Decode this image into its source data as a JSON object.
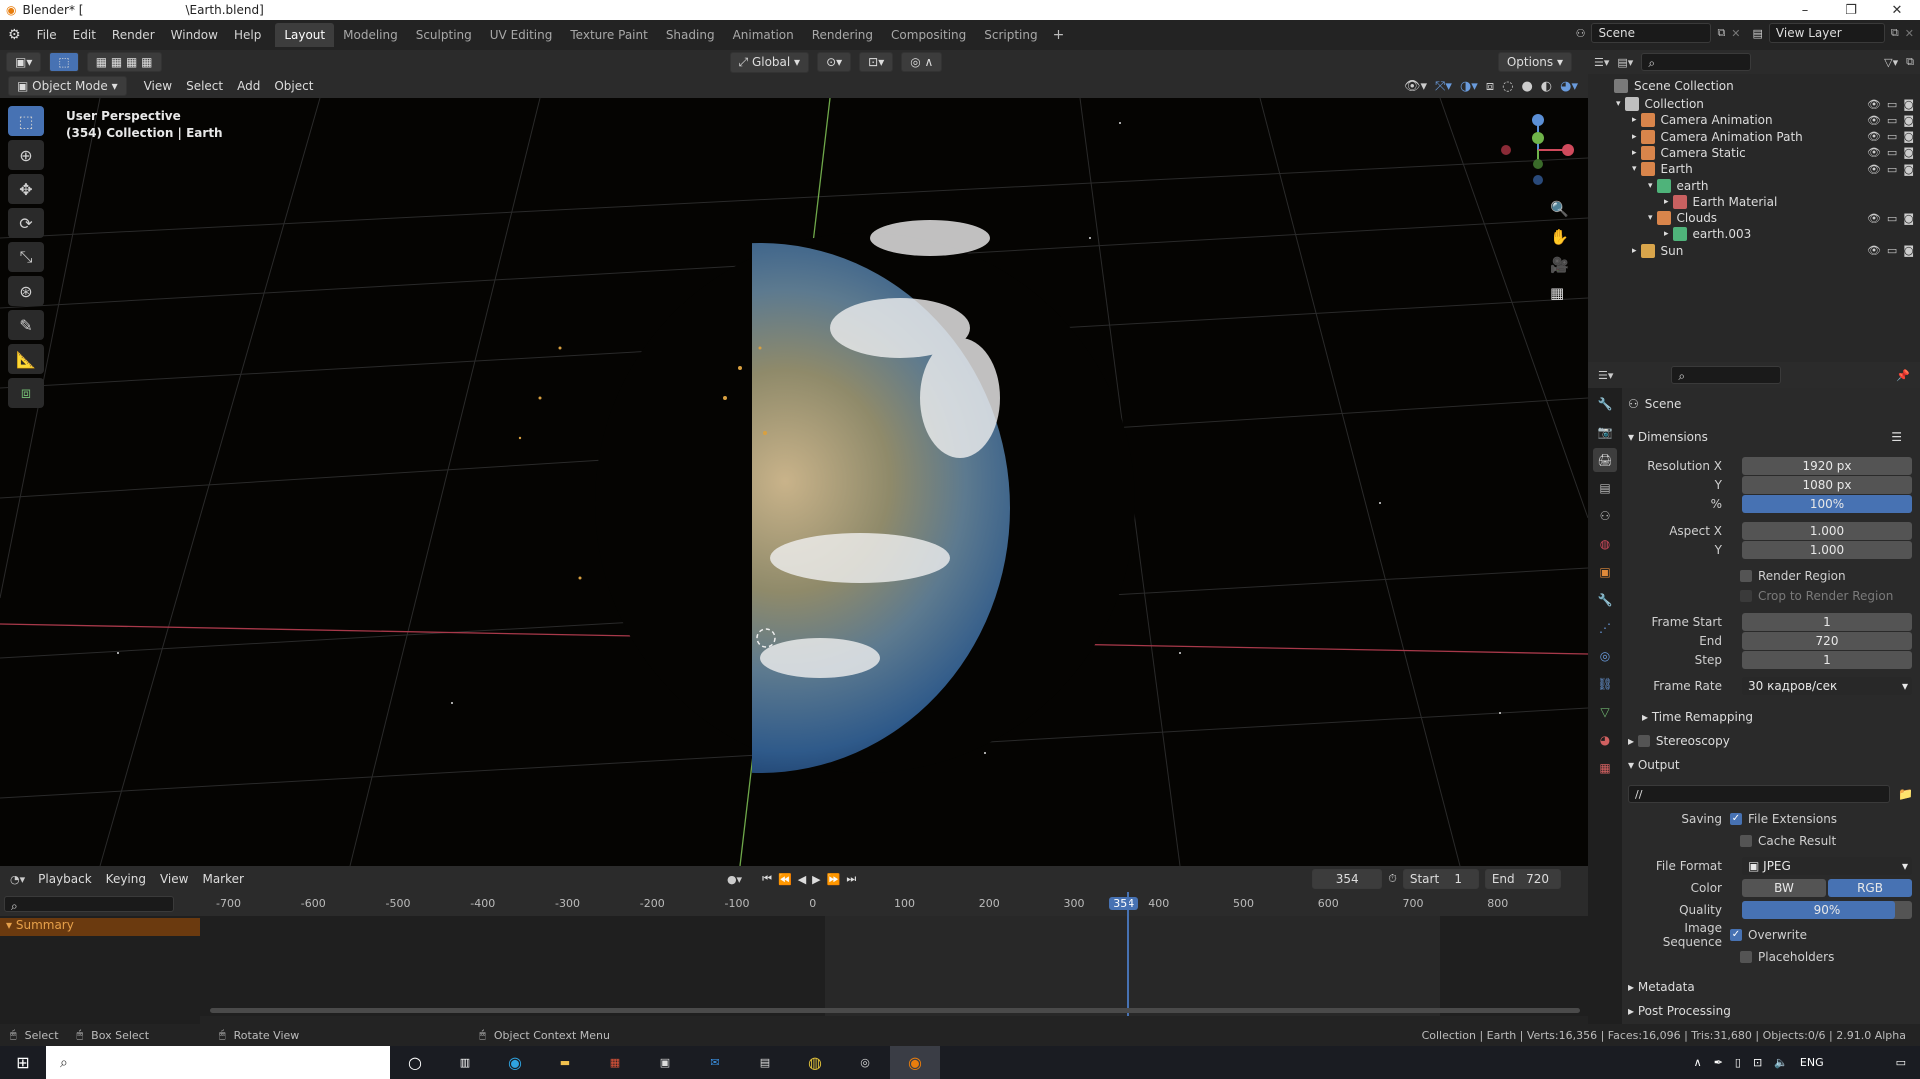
{
  "window": {
    "title": "Blender* [",
    "file": "\\Earth.blend]",
    "minimize": "–",
    "maximize": "❐",
    "close": "✕"
  },
  "menu": [
    "File",
    "Edit",
    "Render",
    "Window",
    "Help"
  ],
  "workspaces": [
    "Layout",
    "Modeling",
    "Sculpting",
    "UV Editing",
    "Texture Paint",
    "Shading",
    "Animation",
    "Rendering",
    "Compositing",
    "Scripting"
  ],
  "active_workspace": "Layout",
  "add_workspace": "+",
  "scene_name": "Scene",
  "view_layer": "View Layer",
  "viewport": {
    "transform_orientation": "Global",
    "options": "Options",
    "mode": "Object Mode",
    "menus": [
      "View",
      "Select",
      "Add",
      "Object"
    ],
    "perspective": "User Perspective",
    "collection_info": "(354) Collection | Earth"
  },
  "outliner": {
    "root": "Scene Collection",
    "rows": [
      {
        "label": "Collection",
        "indent": 0,
        "icon": "#bfbfbf",
        "eyes": true
      },
      {
        "label": "Camera Animation",
        "indent": 1,
        "icon": "#d9854b",
        "eyes": true
      },
      {
        "label": "Camera Animation Path",
        "indent": 1,
        "icon": "#d9854b",
        "eyes": true
      },
      {
        "label": "Camera Static",
        "indent": 1,
        "icon": "#d9854b",
        "eyes": true
      },
      {
        "label": "Earth",
        "indent": 1,
        "icon": "#d9854b",
        "eyes": true
      },
      {
        "label": "earth",
        "indent": 2,
        "icon": "#4fb37a",
        "eyes": false
      },
      {
        "label": "Earth Material",
        "indent": 3,
        "icon": "#c86060",
        "eyes": false
      },
      {
        "label": "Clouds",
        "indent": 2,
        "icon": "#d9854b",
        "eyes": true
      },
      {
        "label": "earth.003",
        "indent": 3,
        "icon": "#4fb37a",
        "eyes": false
      },
      {
        "label": "Sun",
        "indent": 1,
        "icon": "#d9a54b",
        "eyes": true
      }
    ]
  },
  "properties": {
    "context": "Scene",
    "dimensions": "Dimensions",
    "resolution_x_label": "Resolution X",
    "resolution_x": "1920 px",
    "resolution_y_label": "Y",
    "resolution_y": "1080 px",
    "resolution_pct_label": "%",
    "resolution_pct": "100%",
    "aspect_x_label": "Aspect X",
    "aspect_x": "1.000",
    "aspect_y_label": "Y",
    "aspect_y": "1.000",
    "render_region": "Render Region",
    "crop_region": "Crop to Render Region",
    "frame_start_label": "Frame Start",
    "frame_start": "1",
    "frame_end_label": "End",
    "frame_end": "720",
    "frame_step_label": "Step",
    "frame_step": "1",
    "frame_rate_label": "Frame Rate",
    "frame_rate": "30 кадров/сек",
    "time_remapping": "Time Remapping",
    "stereoscopy": "Stereoscopy",
    "output": "Output",
    "output_path": "//",
    "saving_label": "Saving",
    "file_extensions": "File Extensions",
    "cache_result": "Cache Result",
    "file_format_label": "File Format",
    "file_format": "JPEG",
    "color_label": "Color",
    "color_bw": "BW",
    "color_rgb": "RGB",
    "quality_label": "Quality",
    "quality": "90%",
    "image_sequence_label": "Image Sequence",
    "overwrite": "Overwrite",
    "placeholders": "Placeholders",
    "metadata": "Metadata",
    "post_processing": "Post Processing"
  },
  "timeline": {
    "menus": [
      "Playback",
      "Keying",
      "View",
      "Marker"
    ],
    "current_frame": "354",
    "start_label": "Start",
    "start": "1",
    "end_label": "End",
    "end": "720",
    "ruler": [
      "-700",
      "-600",
      "-500",
      "-400",
      "-300",
      "-200",
      "-100",
      "0",
      "100",
      "200",
      "300",
      "354",
      "400",
      "500",
      "600",
      "700",
      "800"
    ],
    "summary": "Summary"
  },
  "status": {
    "select": "Select",
    "box_select": "Box Select",
    "rotate": "Rotate View",
    "context_menu": "Object Context Menu",
    "info": "Collection | Earth | Verts:16,356 | Faces:16,096 | Tris:31,680 | Objects:0/6 | 2.91.0 Alpha"
  },
  "taskbar": {
    "lang": "ENG"
  }
}
